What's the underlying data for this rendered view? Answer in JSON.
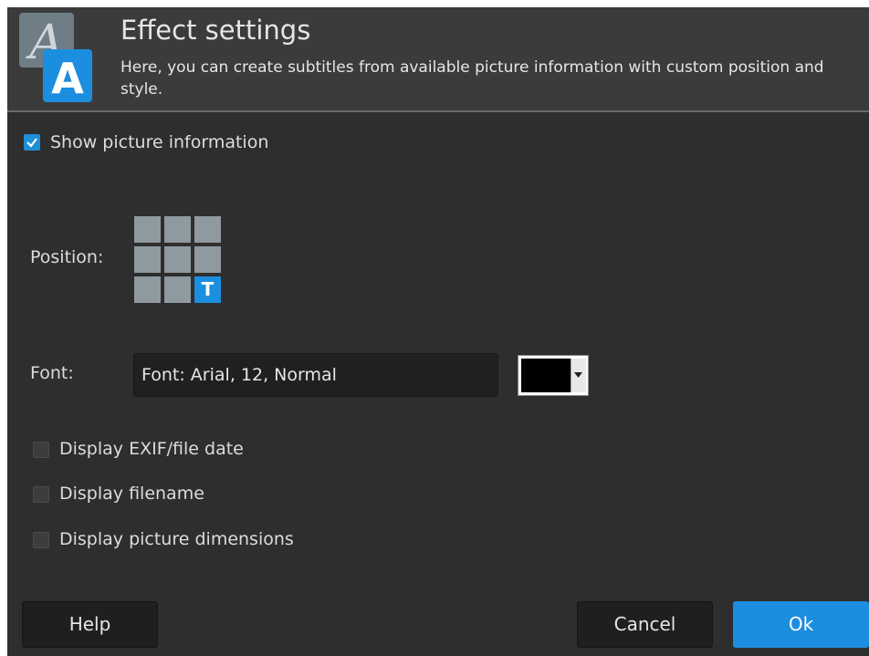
{
  "header": {
    "title": "Effect settings",
    "subtitle": "Here, you can create subtitles from available picture information with custom position and style.",
    "icon": "subtitle-app-icon"
  },
  "show_info": {
    "label": "Show picture information",
    "checked": true
  },
  "position": {
    "label": "Position:",
    "selected_cell": "bottom-right",
    "marker": "T"
  },
  "font": {
    "label": "Font:",
    "value": "Font: Arial, 12, Normal",
    "color": "#000000"
  },
  "options": [
    {
      "label": "Display EXIF/file date",
      "checked": false
    },
    {
      "label": "Display filename",
      "checked": false
    },
    {
      "label": "Display picture dimensions",
      "checked": false
    }
  ],
  "buttons": {
    "help": "Help",
    "cancel": "Cancel",
    "ok": "Ok"
  },
  "colors": {
    "accent": "#1c8ee0",
    "background": "#2e2e2e",
    "header": "#3b3b3b"
  }
}
